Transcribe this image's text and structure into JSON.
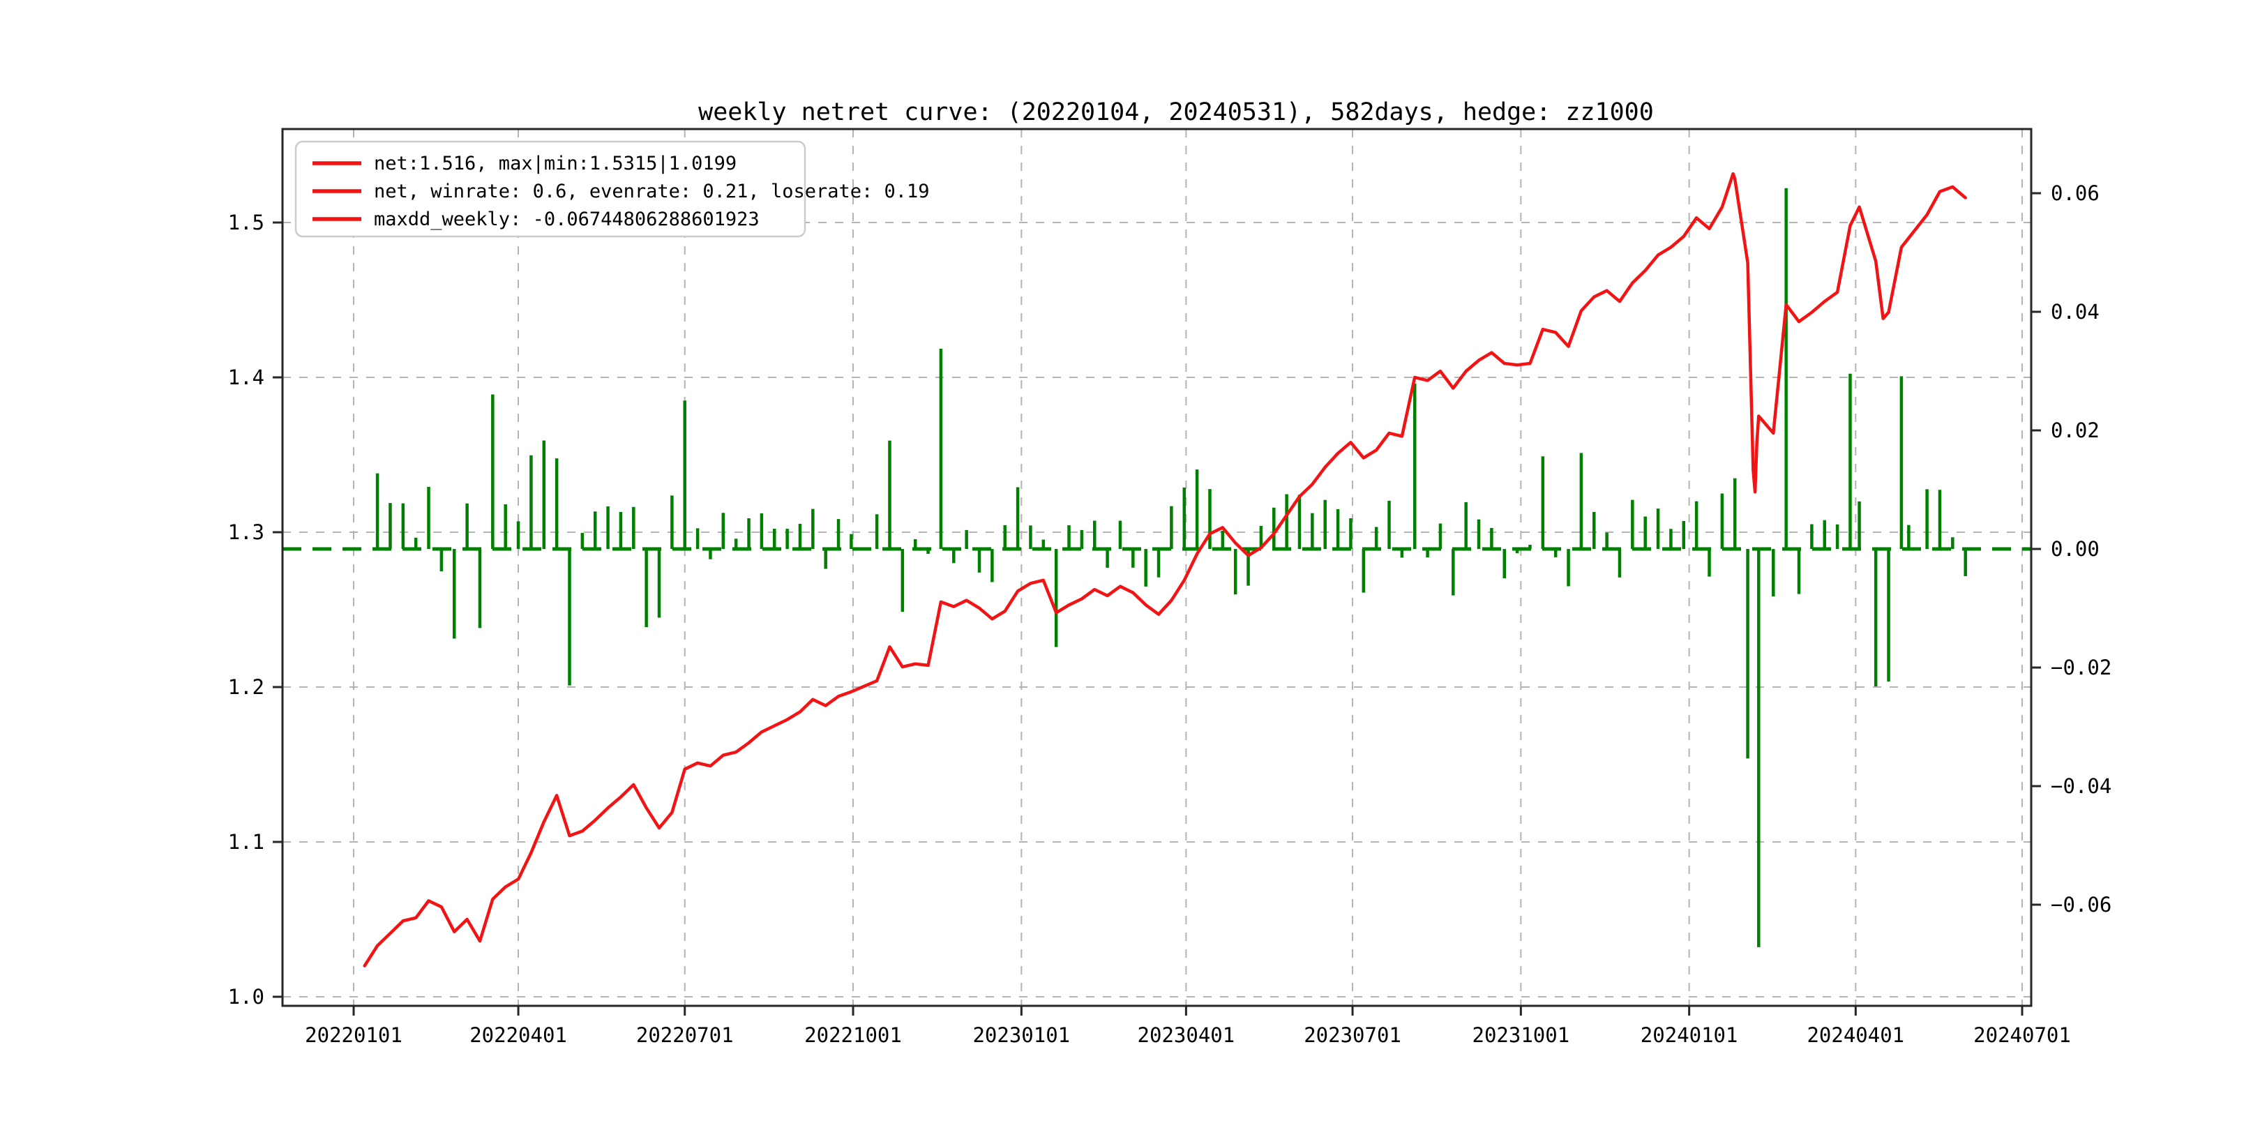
{
  "chart_data": {
    "type": "line+bar",
    "title": "weekly netret curve: (20220104, 20240531), 582days, hedge: zz1000",
    "legend_position": "upper left",
    "grid": true,
    "legend": {
      "items": [
        "net:1.516, max|min:1.5315|1.0199",
        "net, winrate: 0.6, evenrate: 0.21, loserate: 0.19",
        "maxdd_weekly: -0.06744806288601923"
      ]
    },
    "colors": {
      "net_line": "#f21414",
      "bars": "#008000",
      "zero_line": "#008000",
      "grid": "#b3b3b3",
      "spine": "#262626"
    },
    "x_ticks": [
      "20220101",
      "20220401",
      "20220701",
      "20221001",
      "20230101",
      "20230401",
      "20230701",
      "20231001",
      "20240101",
      "20240401",
      "20240701"
    ],
    "x_range": [
      "20220101",
      "20240701"
    ],
    "left_axis": {
      "tick_labels": [
        "1.0",
        "1.1",
        "1.2",
        "1.3",
        "1.4",
        "1.5"
      ],
      "tick_values": [
        1.0,
        1.1,
        1.2,
        1.3,
        1.4,
        1.5
      ],
      "ylim": [
        0.994,
        1.56
      ]
    },
    "right_axis": {
      "tick_labels": [
        "0.06",
        "0.04",
        "0.02",
        "0.00",
        "−0.02",
        "−0.04",
        "−0.06"
      ],
      "tick_values": [
        0.06,
        0.04,
        0.02,
        0.0,
        -0.02,
        -0.04,
        -0.06
      ],
      "ylim": [
        -0.0771,
        0.0708
      ]
    },
    "baseline_right_value": 0.0,
    "bars_note": "green bars = weekly returns derived from consecutive net_weekly values, plotted on right axis",
    "net_weekly": [
      [
        "20220107",
        1.02
      ],
      [
        "20220114",
        1.033
      ],
      [
        "20220121",
        1.041
      ],
      [
        "20220128",
        1.049
      ],
      [
        "20220204",
        1.051
      ],
      [
        "20220211",
        1.062
      ],
      [
        "20220218",
        1.058
      ],
      [
        "20220225",
        1.042
      ],
      [
        "20220304",
        1.05
      ],
      [
        "20220311",
        1.036
      ],
      [
        "20220318",
        1.063
      ],
      [
        "20220325",
        1.071
      ],
      [
        "20220401",
        1.076
      ],
      [
        "20220408",
        1.093
      ],
      [
        "20220415",
        1.113
      ],
      [
        "20220422",
        1.13
      ],
      [
        "20220429",
        1.104
      ],
      [
        "20220506",
        1.107
      ],
      [
        "20220513",
        1.114
      ],
      [
        "20220520",
        1.122
      ],
      [
        "20220527",
        1.129
      ],
      [
        "20220603",
        1.137
      ],
      [
        "20220610",
        1.122
      ],
      [
        "20220617",
        1.109
      ],
      [
        "20220624",
        1.119
      ],
      [
        "20220701",
        1.147
      ],
      [
        "20220708",
        1.151
      ],
      [
        "20220715",
        1.149
      ],
      [
        "20220722",
        1.156
      ],
      [
        "20220729",
        1.158
      ],
      [
        "20220805",
        1.164
      ],
      [
        "20220812",
        1.171
      ],
      [
        "20220819",
        1.175
      ],
      [
        "20220826",
        1.179
      ],
      [
        "20220902",
        1.184
      ],
      [
        "20220909",
        1.192
      ],
      [
        "20220916",
        1.188
      ],
      [
        "20220923",
        1.194
      ],
      [
        "20220930",
        1.197
      ],
      [
        "20221014",
        1.204
      ],
      [
        "20221021",
        1.226
      ],
      [
        "20221028",
        1.213
      ],
      [
        "20221104",
        1.215
      ],
      [
        "20221111",
        1.214
      ],
      [
        "20221118",
        1.255
      ],
      [
        "20221125",
        1.252
      ],
      [
        "20221202",
        1.256
      ],
      [
        "20221209",
        1.251
      ],
      [
        "20221216",
        1.244
      ],
      [
        "20221223",
        1.249
      ],
      [
        "20221230",
        1.262
      ],
      [
        "20230106",
        1.267
      ],
      [
        "20230113",
        1.269
      ],
      [
        "20230120",
        1.248
      ],
      [
        "20230127",
        1.253
      ],
      [
        "20230203",
        1.257
      ],
      [
        "20230210",
        1.263
      ],
      [
        "20230217",
        1.259
      ],
      [
        "20230224",
        1.265
      ],
      [
        "20230303",
        1.261
      ],
      [
        "20230310",
        1.253
      ],
      [
        "20230317",
        1.247
      ],
      [
        "20230324",
        1.256
      ],
      [
        "20230331",
        1.269
      ],
      [
        "20230407",
        1.286
      ],
      [
        "20230414",
        1.299
      ],
      [
        "20230421",
        1.303
      ],
      [
        "20230428",
        1.293
      ],
      [
        "20230505",
        1.285
      ],
      [
        "20230512",
        1.29
      ],
      [
        "20230519",
        1.299
      ],
      [
        "20230526",
        1.311
      ],
      [
        "20230602",
        1.323
      ],
      [
        "20230609",
        1.331
      ],
      [
        "20230616",
        1.342
      ],
      [
        "20230623",
        1.351
      ],
      [
        "20230630",
        1.358
      ],
      [
        "20230707",
        1.348
      ],
      [
        "20230714",
        1.353
      ],
      [
        "20230721",
        1.364
      ],
      [
        "20230728",
        1.362
      ],
      [
        "20230804",
        1.4
      ],
      [
        "20230811",
        1.398
      ],
      [
        "20230818",
        1.404
      ],
      [
        "20230825",
        1.393
      ],
      [
        "20230901",
        1.404
      ],
      [
        "20230908",
        1.411
      ],
      [
        "20230915",
        1.416
      ],
      [
        "20230922",
        1.409
      ],
      [
        "20230929",
        1.408
      ],
      [
        "20231006",
        1.409
      ],
      [
        "20231013",
        1.431
      ],
      [
        "20231020",
        1.429
      ],
      [
        "20231027",
        1.42
      ],
      [
        "20231103",
        1.443
      ],
      [
        "20231110",
        1.452
      ],
      [
        "20231117",
        1.456
      ],
      [
        "20231124",
        1.449
      ],
      [
        "20231201",
        1.461
      ],
      [
        "20231208",
        1.469
      ],
      [
        "20231215",
        1.479
      ],
      [
        "20231222",
        1.484
      ],
      [
        "20231229",
        1.491
      ],
      [
        "20240105",
        1.503
      ],
      [
        "20240112",
        1.496
      ],
      [
        "20240119",
        1.51
      ],
      [
        "20240126",
        1.528
      ],
      [
        "20240202",
        1.474
      ],
      [
        "20240208",
        1.375
      ],
      [
        "20240216",
        1.364
      ],
      [
        "20240223",
        1.447
      ],
      [
        "20240301",
        1.436
      ],
      [
        "20240308",
        1.442
      ],
      [
        "20240315",
        1.449
      ],
      [
        "20240322",
        1.455
      ],
      [
        "20240329",
        1.498
      ],
      [
        "20240403",
        1.51
      ],
      [
        "20240412",
        1.475
      ],
      [
        "20240419",
        1.442
      ],
      [
        "20240426",
        1.484
      ],
      [
        "20240430",
        1.49
      ],
      [
        "20240510",
        1.505
      ],
      [
        "20240517",
        1.52
      ],
      [
        "20240524",
        1.523
      ],
      [
        "20240531",
        1.516
      ]
    ],
    "net_daily_extra": [
      [
        "20240125",
        1.5315
      ],
      [
        "20240205",
        1.34
      ],
      [
        "20240206",
        1.326
      ],
      [
        "20240207",
        1.358
      ],
      [
        "20240416",
        1.438
      ]
    ],
    "stats": {
      "net_end": 1.516,
      "net_max": 1.5315,
      "net_min": 1.0199,
      "winrate": 0.6,
      "evenrate": 0.21,
      "loserate": 0.19,
      "maxdd_weekly": -0.06744806288601923,
      "days": 582,
      "hedge": "zz1000",
      "period_start": "20220104",
      "period_end": "20240531"
    }
  }
}
